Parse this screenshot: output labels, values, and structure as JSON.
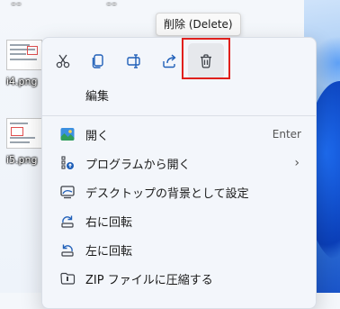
{
  "desktop": {
    "files": [
      {
        "name": "i4.png"
      },
      {
        "name": "i5.png"
      }
    ]
  },
  "tooltip": {
    "text": "削除 (Delete)"
  },
  "toolbar": {
    "cut_icon": "scissors-icon",
    "copy_icon": "copy-icon",
    "rename_icon": "rename-icon",
    "share_icon": "share-icon",
    "delete_icon": "trash-icon"
  },
  "menu": {
    "edit_label": "編集",
    "items": [
      {
        "label": "開く",
        "shortcut": "Enter",
        "icon": "photos-app-icon"
      },
      {
        "label": "プログラムから開く",
        "icon": "open-with-icon"
      },
      {
        "label": "デスクトップの背景として設定",
        "icon": "desktop-background-icon"
      },
      {
        "label": "右に回転",
        "icon": "rotate-right-icon"
      },
      {
        "label": "左に回転",
        "icon": "rotate-left-icon"
      },
      {
        "label": "ZIP ファイルに圧縮する",
        "icon": "zip-icon"
      }
    ]
  },
  "colors": {
    "highlight": "#e0201c",
    "accent": "#0067c0"
  }
}
